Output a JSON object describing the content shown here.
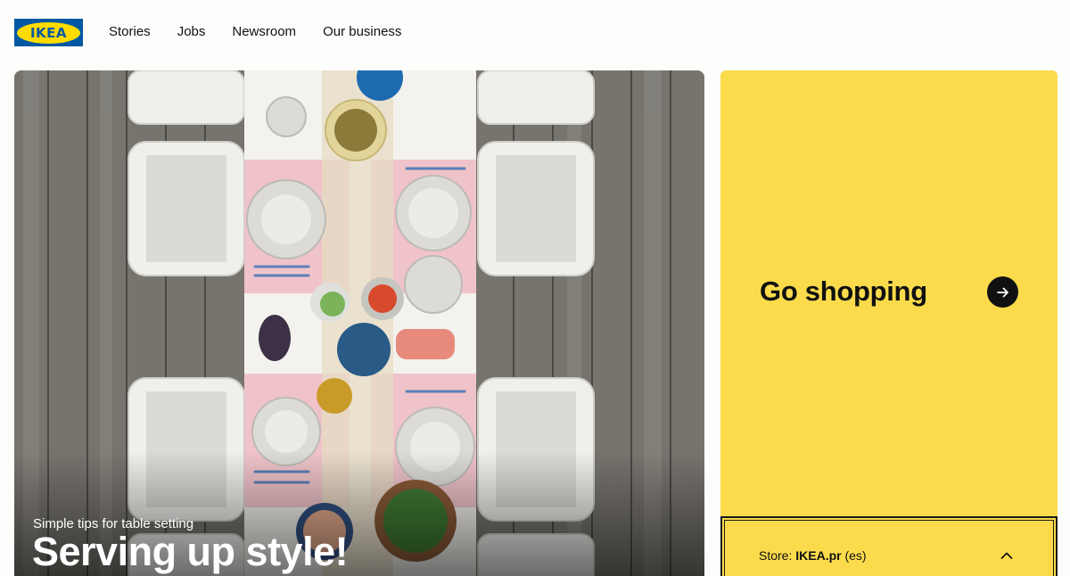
{
  "header": {
    "logo_text": "IKEA",
    "nav": [
      "Stories",
      "Jobs",
      "Newsroom",
      "Our business"
    ]
  },
  "hero": {
    "kicker": "Simple tips for table setting",
    "title": "Serving up style!",
    "image_icon": "table-setting-photo"
  },
  "shop": {
    "label": "Go shopping",
    "icon": "arrow-right-icon"
  },
  "store": {
    "prefix": "Store: ",
    "name": "IKEA.pr",
    "lang": " (es)",
    "icon": "chevron-up-icon"
  },
  "colors": {
    "brand_blue": "#0058a3",
    "brand_yellow": "#ffdb00",
    "card_yellow": "#fbdb4c",
    "text": "#111111"
  }
}
